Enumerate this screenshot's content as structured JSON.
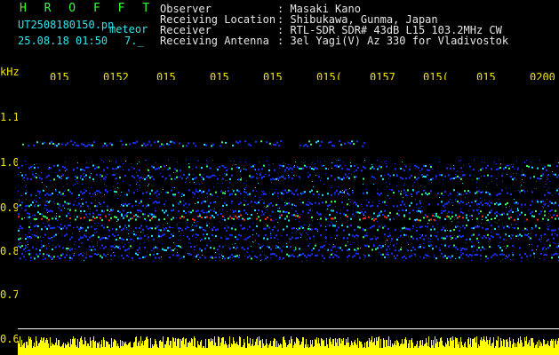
{
  "header": {
    "app_name": "H R O F F T",
    "filename": "UT2508180150.pn",
    "mode": "meteor",
    "datetime": "25.08.18 01:50",
    "counter": "7._",
    "fields": [
      {
        "label": "Observer",
        "value": ": Masaki Kano"
      },
      {
        "label": "Receiving Location",
        "value": ": Shibukawa, Gunma, Japan"
      },
      {
        "label": "Receiver",
        "value": ": RTL-SDR SDR# 43dB L15 103.2MHz CW"
      },
      {
        "label": "Receiving Antenna",
        "value": ": 3el Yagi(V) Az 330 for Vladivostok"
      }
    ]
  },
  "axes": {
    "y_unit": "kHz",
    "y_ticks": [
      "1.1",
      "1.0",
      "0.9",
      "0.8",
      "0.7",
      "0.6"
    ],
    "x_ticks": [
      "015",
      "0152",
      "015",
      "015",
      "015",
      "015(",
      "0157",
      "015(",
      "015",
      "0200"
    ]
  },
  "colors": {
    "background": "#000000",
    "title_green": "#35ff35",
    "text_cyan": "#2ee6ee",
    "axis_yellow": "#f2e600",
    "signal_blue": "#1730ff",
    "signal_cyan": "#22e0ff",
    "signal_green": "#3dff66",
    "signal_red": "#ff2a1a",
    "noise_yellow": "#ffff00"
  },
  "spectrum": {
    "bands_khz": [
      1.04,
      0.985,
      0.965,
      0.93,
      0.905,
      0.885,
      0.873,
      0.85,
      0.83,
      0.805,
      0.787
    ],
    "strong_band_khz": 0.873
  }
}
